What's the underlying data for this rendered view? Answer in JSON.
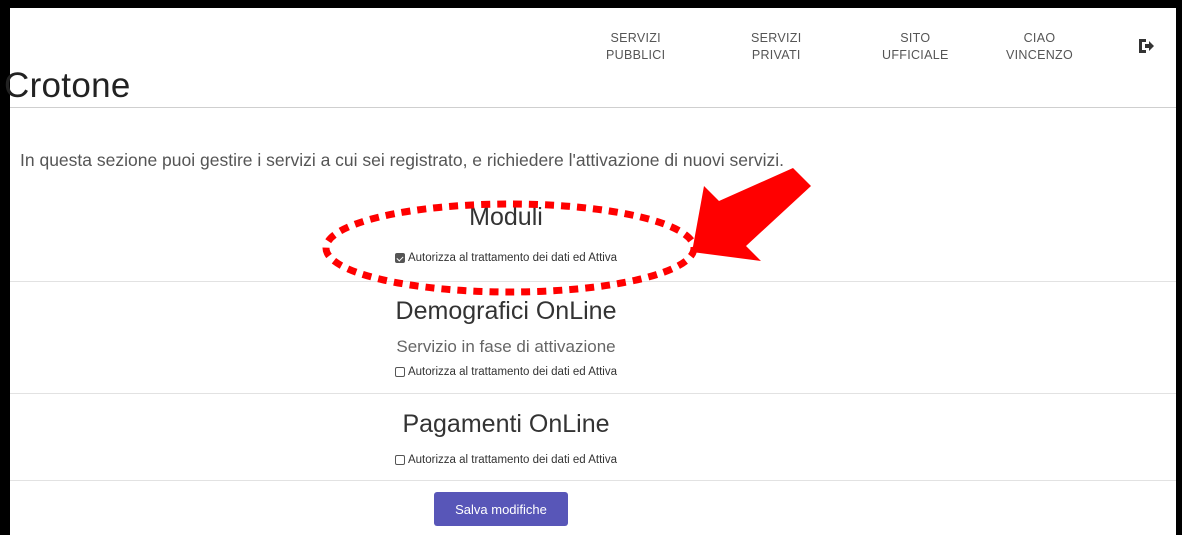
{
  "header": {
    "brand": "Crotone",
    "nav": [
      {
        "line1": "SERVIZI",
        "line2": "PUBBLICI"
      },
      {
        "line1": "SERVIZI",
        "line2": "PRIVATI"
      },
      {
        "line1": "SITO",
        "line2": "UFFICIALE"
      },
      {
        "line1": "CIAO",
        "line2": "VINCENZO"
      }
    ],
    "logout_icon": "logout-icon"
  },
  "intro": "In questa sezione puoi gestire i servizi a cui sei registrato, e richiedere l'attivazione di nuovi servizi.",
  "services": [
    {
      "title": "Moduli",
      "status": "",
      "consent": "Autorizza al trattamento dei dati ed Attiva",
      "checked": true
    },
    {
      "title": "Demografici OnLine",
      "status": "Servizio in fase di attivazione",
      "consent": "Autorizza al trattamento dei dati ed Attiva",
      "checked": false
    },
    {
      "title": "Pagamenti OnLine",
      "status": "",
      "consent": "Autorizza al trattamento dei dati ed Attiva",
      "checked": false
    }
  ],
  "save_label": "Salva modifiche",
  "colors": {
    "button": "#5856b8",
    "annotation": "#ff0000"
  }
}
